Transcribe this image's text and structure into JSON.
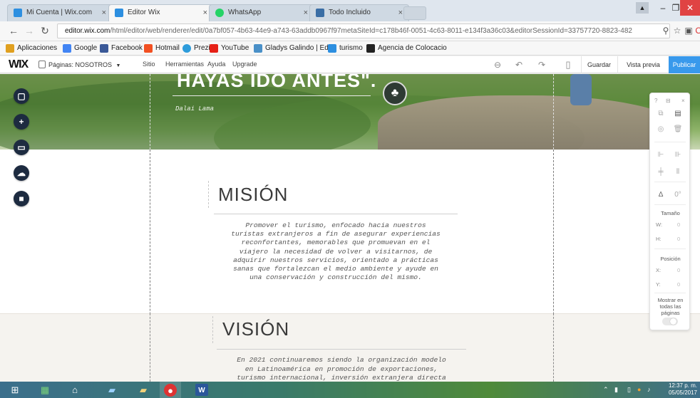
{
  "browser": {
    "tabs": [
      {
        "title": "Mi Cuenta | Wix.com",
        "color": "#2d8fe0"
      },
      {
        "title": "Editor Wix",
        "color": "#2d8fe0"
      },
      {
        "title": "WhatsApp",
        "color": "#25d366"
      },
      {
        "title": "Todo Incluido",
        "color": "#3a6ea5"
      }
    ],
    "url_domain": "editor.wix.com",
    "url_rest": "/html/editor/web/renderer/edit/0a7bf057-4b63-44e9-a743-63addb0967f97metaSiteId=c178b46f-0051-4c63-8011-e134f3a36c03&editorSessionId=33757720-8823-482",
    "bookmarks": [
      {
        "label": "Aplicaciones",
        "color": "#e0a020"
      },
      {
        "label": "Google",
        "color": "#4285f4"
      },
      {
        "label": "Facebook",
        "color": "#3b5998"
      },
      {
        "label": "Hotmail",
        "color": "#f25022"
      },
      {
        "label": "Prezi",
        "color": "#2d9cdb"
      },
      {
        "label": "YouTube",
        "color": "#e62117"
      },
      {
        "label": "Gladys Galindo | Edi",
        "color": "#4a90c8"
      },
      {
        "label": "turismo",
        "color": "#2d8fe0"
      },
      {
        "label": "Agencia de Colocacio",
        "color": "#222222"
      }
    ]
  },
  "wix": {
    "logo": "WIX",
    "page_selector": "Páginas: NOSOTROS",
    "menu": [
      "Sitio",
      "Herramientas",
      "Ayuda",
      "Upgrade"
    ],
    "save": "Guardar",
    "preview": "Vista previa",
    "publish": "Publicar"
  },
  "hero": {
    "title": "HAYAS IDO ANTES\".",
    "author": "Dalai Lama"
  },
  "mission": {
    "title": "MISIÓN",
    "lines": [
      "Promover el turismo, enfocado hacia nuestros",
      "turistas extranjeros a fin de asegurar experiencias",
      "reconfortantes, memorables que promuevan en el",
      "viajero la necesidad de volver a visitarnos, de",
      "adquirir nuestros servicios, orientado a prácticas",
      "sanas que fortalezcan el medio ambiente y ayude en",
      "una conservación y construcción del mismo."
    ]
  },
  "vision": {
    "title": "VISIÓN",
    "lines": [
      "En 2021 continuaremos siendo la organización modelo",
      "en Latinoamérica en promoción de exportaciones,",
      "turismo internacional, inversión extranjera directa"
    ]
  },
  "inspector": {
    "size_label": "Tamaño",
    "w_label": "W:",
    "h_label": "H:",
    "w_value": "0",
    "h_value": "0",
    "position_label": "Posición",
    "x_label": "X:",
    "y_label": "Y:",
    "x_value": "0",
    "y_value": "0",
    "show_all_pages": "Mostrar en todas las páginas"
  },
  "taskbar": {
    "time": "12:37 p. m.",
    "date": "05/05/2017"
  },
  "colors": {
    "wix_blue": "#3899ec",
    "left_tool_bg": "#1d2b40",
    "vision_bg": "#f5f3ef"
  }
}
